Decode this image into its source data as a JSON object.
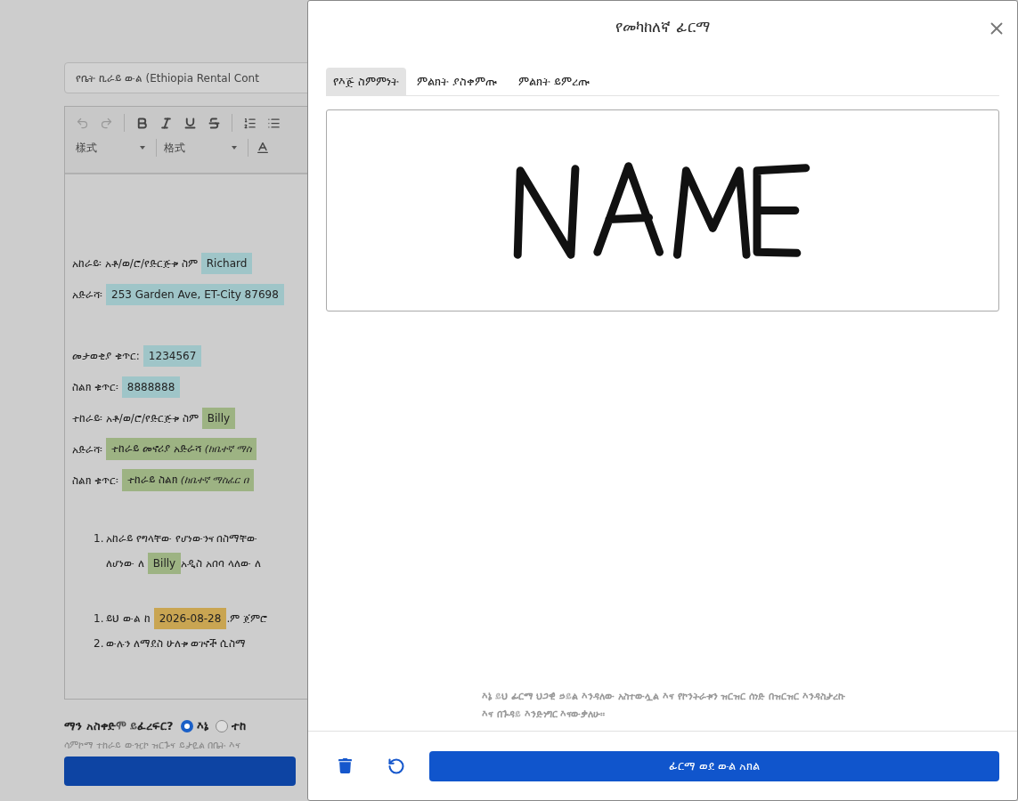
{
  "document": {
    "title_value": "የቤት ኪራይ ውል (Ethiopia Rental Cont",
    "toolbar": {
      "style_select": "樣式",
      "format_select": "格式"
    },
    "lines": [
      {
        "kind": "gap"
      },
      {
        "kind": "line",
        "segments": [
          {
            "kind": "text",
            "text": "አከራይ፡ አቶ/ወ/ሮ/የድርጅቱ ስም"
          },
          {
            "kind": "field",
            "text": "Richard",
            "color": "#9fc5c8"
          }
        ]
      },
      {
        "kind": "line",
        "segments": [
          {
            "kind": "text",
            "text": "አድራሻ፡"
          },
          {
            "kind": "field",
            "text": "253 Garden Ave, ET-City 87698",
            "color": "#9fc5c8"
          }
        ]
      },
      {
        "kind": "gap"
      },
      {
        "kind": "line",
        "segments": [
          {
            "kind": "text",
            "text": "መታወቂያ ቁጥር:"
          },
          {
            "kind": "field",
            "text": "1234567",
            "color": "#9fc5c8"
          }
        ]
      },
      {
        "kind": "line",
        "segments": [
          {
            "kind": "text",
            "text": "ስልክ ቁጥር፡"
          },
          {
            "kind": "field",
            "text": "8888888",
            "color": "#9fc5c8"
          }
        ]
      },
      {
        "kind": "line",
        "segments": [
          {
            "kind": "text",
            "text": "ተከራይ፡ አቶ/ወ/ሮ/የድርጅቱ ስም"
          },
          {
            "kind": "field",
            "text": "Billy",
            "color": "#9db383"
          }
        ]
      },
      {
        "kind": "line",
        "segments": [
          {
            "kind": "text",
            "text": "አድራሻ፡"
          },
          {
            "kind": "field",
            "text": "ተከራይ መኖሪያ አድራሻ",
            "note": "(ከቤተኛ ማስ",
            "color": "#9db383"
          }
        ]
      },
      {
        "kind": "line",
        "segments": [
          {
            "kind": "text",
            "text": "ስልክ ቁጥር፡"
          },
          {
            "kind": "field",
            "text": "ተከራይ ስልክ",
            "note": "(ከቤተኛ ማስፈር በ",
            "color": "#9db383"
          }
        ]
      },
      {
        "kind": "gap"
      },
      {
        "kind": "list",
        "items": [
          {
            "marker": "1.",
            "segments": [
              {
                "kind": "text",
                "text": "አከራይ የግላቸው የሆነውንና በስማቸው"
              }
            ]
          },
          {
            "marker": "",
            "segments": [
              {
                "kind": "text",
                "text": "ለሆነው ለ"
              },
              {
                "kind": "field",
                "text": "Billy",
                "color": "#9db383"
              },
              {
                "kind": "text",
                "text": "አዲስ አበባ ላለው ለ"
              }
            ]
          }
        ]
      },
      {
        "kind": "gap"
      },
      {
        "kind": "list",
        "items": [
          {
            "marker": "1.",
            "segments": [
              {
                "kind": "text",
                "text": "ይህ ውል ከ"
              },
              {
                "kind": "field",
                "text": "2026-08-28",
                "color": "#c9a552"
              },
              {
                "kind": "text",
                "text": ".ም ጀምሮ"
              }
            ]
          },
          {
            "marker": "2.",
            "segments": [
              {
                "kind": "text",
                "text": "ውሉን ለማደስ ሁለቱ ወገኖች ሲስማ"
              }
            ]
          }
        ]
      }
    ],
    "signer_question": "ማን አስቀድሞ ይፈረፍር?",
    "signer_options": [
      {
        "label": "እኔ",
        "selected": true
      },
      {
        "label": "ተከ",
        "selected": false
      }
    ],
    "signer_hint": "ሳምኮማ ተከራይ ውዢኮ ዝርጉና ይታዪል በቤት እና"
  },
  "dialog": {
    "title": "የመካከለኛ ፊርማ",
    "tabs": [
      {
        "label": "የእጅ ስምምነት",
        "selected": true
      },
      {
        "label": "ምልክት ያስቀምጡ",
        "selected": false
      },
      {
        "label": "ምልክት ይምረጡ",
        "selected": false
      }
    ],
    "consent": "እኔ ይህ ፊርማ ህጋዊ ኃይል እንዳለው አስተውሏል እና የኮንትራቱን ዝርዝር ሰነድ በዝርዝር እንዳስታረኩ እና በጉዳይ እንድነግር እናውቃለሁ።",
    "submit_button": "ፊርማ ወደ ውል አክል"
  }
}
